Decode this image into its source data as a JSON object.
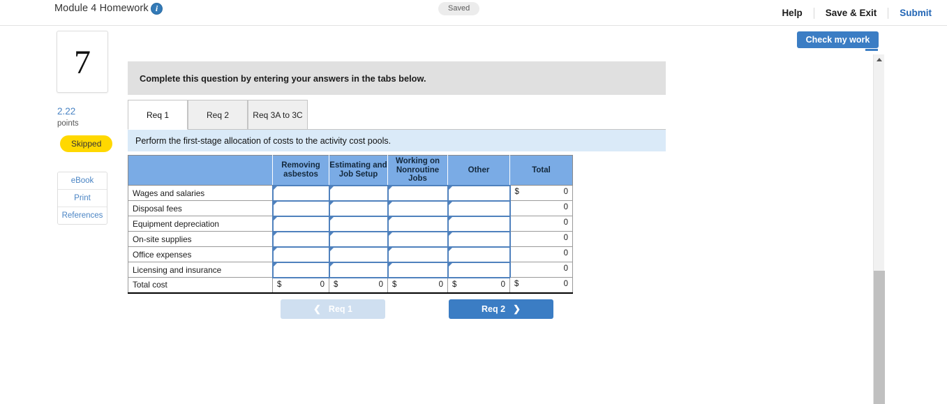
{
  "header": {
    "title": "Module 4 Homework",
    "info_icon": "info-icon",
    "status": "Saved",
    "help_label": "Help",
    "save_exit_label": "Save & Exit",
    "submit_label": "Submit"
  },
  "sidebar": {
    "question_number": "7",
    "points_value": "2.22",
    "points_label": "points",
    "status_badge": "Skipped",
    "buttons": [
      {
        "label": "eBook"
      },
      {
        "label": "Print"
      },
      {
        "label": "References"
      }
    ]
  },
  "toolbar": {
    "check_my_work_label": "Check my work"
  },
  "main": {
    "prompt": "Complete this question by entering your answers in the tabs below.",
    "tabs": [
      {
        "label": "Req 1",
        "active": true
      },
      {
        "label": "Req 2",
        "active": false
      },
      {
        "label": "Req 3A to 3C",
        "active": false
      }
    ],
    "subprompt": "Perform the first-stage allocation of costs to the activity cost pools.",
    "nav": {
      "prev_label": "Req 1",
      "prev_chevron": "chevron-left-icon",
      "prev_disabled": true,
      "next_label": "Req 2",
      "next_chevron": "chevron-right-icon"
    }
  },
  "table": {
    "columns": [
      "",
      "Removing asbestos",
      "Estimating and Job Setup",
      "Working on Nonroutine Jobs",
      "Other",
      "Total"
    ],
    "rows": [
      {
        "label": "Wages and salaries",
        "inputs": [
          "",
          "",
          "",
          ""
        ],
        "total_currency": "$",
        "total_value": "0"
      },
      {
        "label": "Disposal fees",
        "inputs": [
          "",
          "",
          "",
          ""
        ],
        "total_currency": "",
        "total_value": "0"
      },
      {
        "label": "Equipment depreciation",
        "inputs": [
          "",
          "",
          "",
          ""
        ],
        "total_currency": "",
        "total_value": "0"
      },
      {
        "label": "On-site supplies",
        "inputs": [
          "",
          "",
          "",
          ""
        ],
        "total_currency": "",
        "total_value": "0"
      },
      {
        "label": "Office expenses",
        "inputs": [
          "",
          "",
          "",
          ""
        ],
        "total_currency": "",
        "total_value": "0"
      },
      {
        "label": "Licensing and insurance",
        "inputs": [
          "",
          "",
          "",
          ""
        ],
        "total_currency": "",
        "total_value": "0"
      }
    ],
    "total_row": {
      "label": "Total cost",
      "cells": [
        {
          "currency": "$",
          "value": "0"
        },
        {
          "currency": "$",
          "value": "0"
        },
        {
          "currency": "$",
          "value": "0"
        },
        {
          "currency": "$",
          "value": "0"
        },
        {
          "currency": "$",
          "value": "0"
        }
      ]
    }
  },
  "scrollbar": {
    "up_arrow": "scroll-up-icon"
  },
  "colors": {
    "accent_blue": "#3b7dc4",
    "table_header_blue": "#7aabe5",
    "subprompt_blue": "#daeaf8",
    "prompt_gray": "#e0e0e0",
    "badge_yellow": "#ffd800",
    "input_border": "#4f81bd"
  }
}
